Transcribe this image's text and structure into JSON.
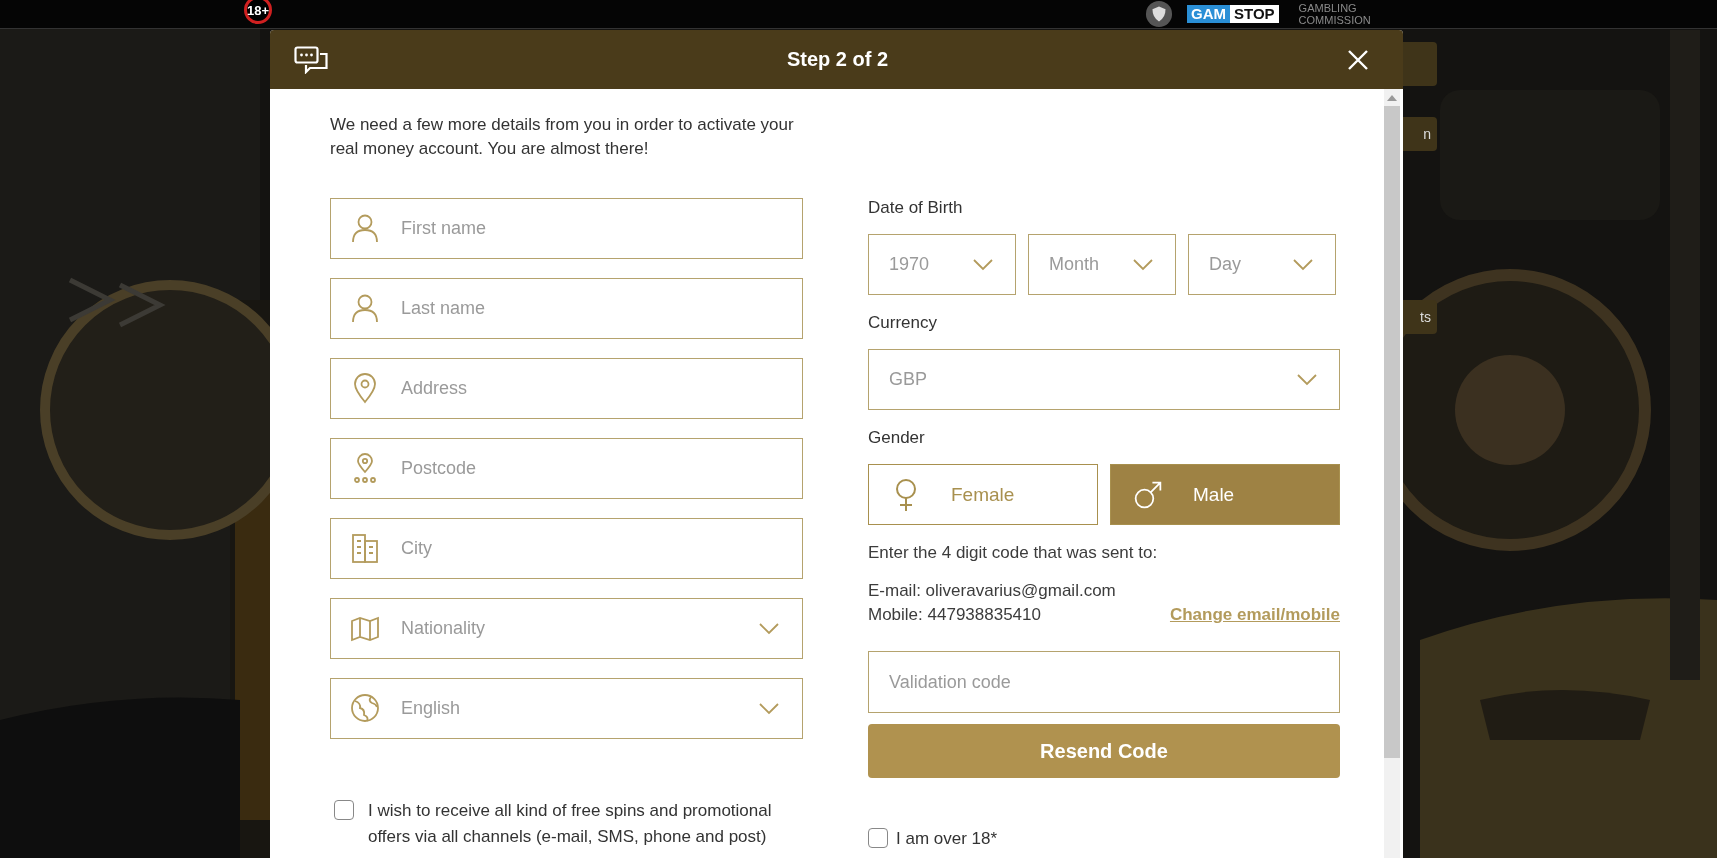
{
  "top_bar": {
    "age_badge": "18+",
    "gamstop": {
      "part_1": "GAM",
      "part_2": "STOP"
    },
    "commission": [
      "GAMBLING",
      "COMMISSION"
    ]
  },
  "background": {
    "kind": "picture",
    "side_buttons": [
      "n",
      "ts"
    ]
  },
  "modal": {
    "title": "Step 2 of 2",
    "intro": "We need a few more details from you in order to activate your real money account. You are almost there!",
    "fields": [
      {
        "kind": "input",
        "placeholder": "First name"
      },
      {
        "kind": "input",
        "placeholder": "Last name"
      },
      {
        "kind": "input",
        "placeholder": "Address"
      },
      {
        "kind": "input",
        "placeholder": "Postcode"
      },
      {
        "kind": "input",
        "placeholder": "City"
      },
      {
        "kind": "select",
        "placeholder": "Nationality"
      },
      {
        "kind": "select",
        "placeholder": "English"
      }
    ],
    "date_of_birth": {
      "label": "Date of Birth",
      "selects": [
        "1970",
        "Month",
        "Day"
      ]
    },
    "currency": {
      "label": "Currency",
      "value": "GBP"
    },
    "gender": {
      "label": "Gender",
      "options": [
        {
          "label": "Female",
          "selected": false
        },
        {
          "label": "Male",
          "selected": true
        }
      ]
    },
    "verification": {
      "instruction": "Enter the 4 digit code that was sent to:",
      "email": "E-mail: oliveravarius@gmail.com",
      "mobile": "Mobile: 447938835410",
      "change_link": "Change email/mobile",
      "placeholder": "Validation code",
      "resend_button": "Resend Code"
    },
    "consents": [
      {
        "label": "I wish to receive all kind of free spins and promotional offers via all channels (e-mail, SMS, phone and post)",
        "checked": false
      },
      {
        "label": "I am over 18*",
        "checked": false
      }
    ]
  }
}
